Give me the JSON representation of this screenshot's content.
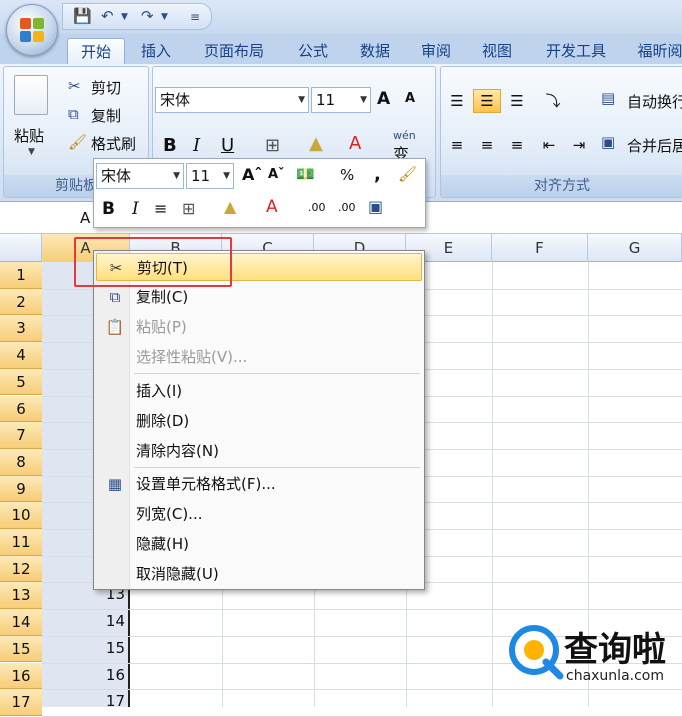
{
  "quick_access": {
    "icons": [
      "save-icon",
      "undo-icon",
      "redo-icon",
      "customize-icon"
    ]
  },
  "tabs": [
    {
      "label": "开始",
      "active": true
    },
    {
      "label": "插入"
    },
    {
      "label": "页面布局"
    },
    {
      "label": "公式"
    },
    {
      "label": "数据"
    },
    {
      "label": "审阅"
    },
    {
      "label": "视图"
    },
    {
      "label": "开发工具"
    },
    {
      "label": "福昕阅"
    }
  ],
  "ribbon": {
    "clipboard": {
      "paste": "粘贴",
      "cut": "剪切",
      "copy": "复制",
      "format_painter": "格式刷",
      "label": "剪贴板"
    },
    "font": {
      "name": "宋体",
      "size": "11",
      "bold": "B",
      "italic": "I",
      "underline": "U",
      "grow": "A",
      "shrink": "A",
      "font_color": "A",
      "wen": "wén",
      "phonetic": "变"
    },
    "alignment": {
      "wrap": "自动换行",
      "merge": "合并后居",
      "label": "对齐方式"
    }
  },
  "minibar": {
    "font_name": "宋体",
    "font_size": "11",
    "bold": "B",
    "italic": "I",
    "percent": "%",
    "comma": ",",
    "inc_dec": ".00",
    "dec_dec": ".00"
  },
  "name_box": "A",
  "columns": [
    "A",
    "B",
    "C",
    "D",
    "E",
    "F",
    "G"
  ],
  "rows": [
    "1",
    "2",
    "3",
    "4",
    "5",
    "6",
    "7",
    "8",
    "9",
    "10",
    "11",
    "12",
    "13",
    "14",
    "15",
    "16",
    "17"
  ],
  "cell_values": {
    "13": "13",
    "14": "14",
    "15": "15",
    "16": "16",
    "17": "17"
  },
  "context_menu": {
    "items": [
      {
        "label": "剪切(T)",
        "icon": "scissors-icon",
        "highlighted": true
      },
      {
        "label": "复制(C)",
        "icon": "copy-icon"
      },
      {
        "label": "粘贴(P)",
        "icon": "paste-icon",
        "disabled": true
      },
      {
        "label": "选择性粘贴(V)...",
        "disabled": true
      },
      {
        "label": "插入(I)"
      },
      {
        "label": "删除(D)"
      },
      {
        "label": "清除内容(N)"
      },
      {
        "label": "设置单元格格式(F)...",
        "icon": "format-cells-icon"
      },
      {
        "label": "列宽(C)..."
      },
      {
        "label": "隐藏(H)"
      },
      {
        "label": "取消隐藏(U)"
      }
    ]
  },
  "watermark": {
    "brand": "查询啦",
    "site": "chaxunla.com"
  },
  "colors": {
    "highlight": "#ffdf7e",
    "row_header": "#f7cd78",
    "red_box": "#e03a3a",
    "ribbon": "#dce8f6"
  }
}
